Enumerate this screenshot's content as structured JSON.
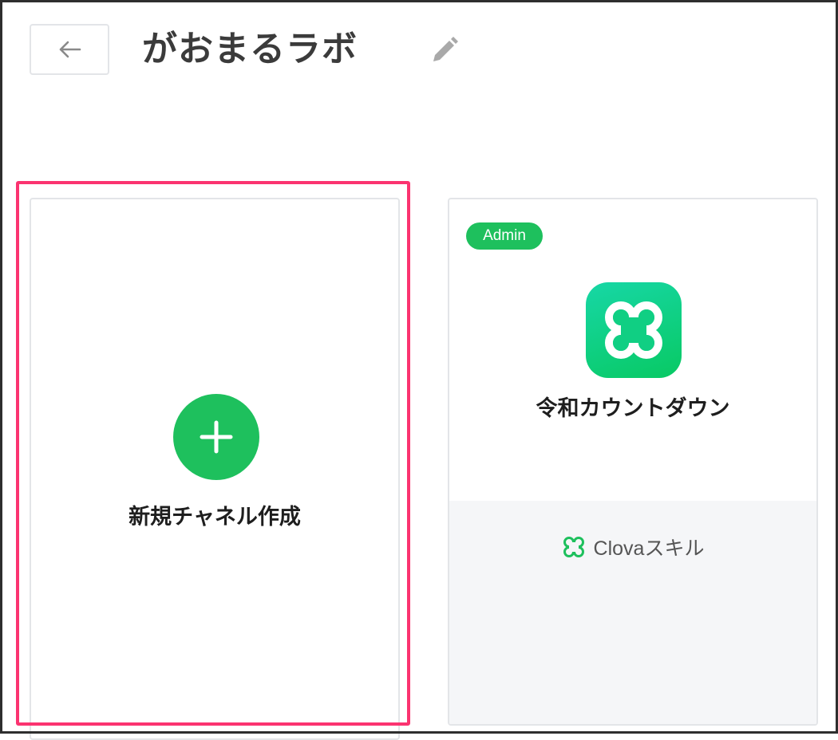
{
  "header": {
    "back_icon": "arrow-left-icon",
    "title": "がおまるラボ",
    "edit_icon": "pencil-icon"
  },
  "new_channel_card": {
    "icon": "plus-icon",
    "label": "新規チャネル作成"
  },
  "channel_card": {
    "badge": "Admin",
    "logo_icon": "clova-logo-icon",
    "name": "令和カウントダウン",
    "footer_icon": "clova-icon",
    "footer_label": "Clovaスキル"
  },
  "colors": {
    "accent_green": "#1ec05d",
    "highlight": "#fb3370",
    "title_text": "#3b3b3b"
  }
}
